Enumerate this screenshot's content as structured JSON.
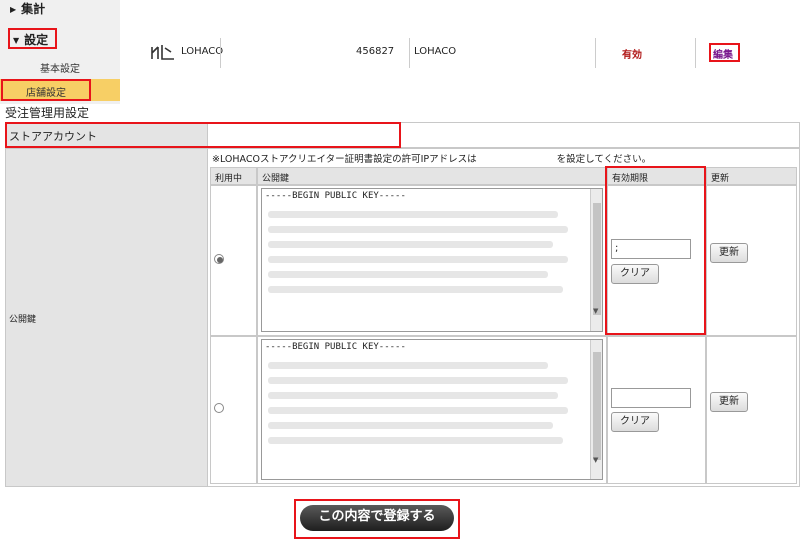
{
  "sidebar": {
    "aggregate_label": "集計",
    "settings_label": "設定",
    "basic_settings": "基本設定",
    "store_settings": "店舗設定"
  },
  "store_row": {
    "logo_text": "LOHACO",
    "store_id": "456827",
    "store_name": "LOHACO",
    "status": "有効",
    "edit_label": "編集"
  },
  "section_title": "受注管理用設定",
  "store_account": {
    "label": "ストアアカウント",
    "value": ""
  },
  "public_key": {
    "label": "公開鍵",
    "notice_prefix": "※LOHACOストアクリエイター証明書設定の許可IPアドレスは",
    "notice_suffix": "を設定してください。",
    "headers": {
      "in_use": "利用中",
      "key": "公開鍵",
      "expiry": "有効期限",
      "update": "更新"
    },
    "rows": [
      {
        "key_text": "-----BEGIN PUBLIC KEY-----",
        "selected": true,
        "expiry_value": ";",
        "clear_label": "クリア",
        "update_label": "更新"
      },
      {
        "key_text": "-----BEGIN PUBLIC KEY-----",
        "selected": false,
        "expiry_value": "",
        "clear_label": "クリア",
        "update_label": "更新"
      }
    ]
  },
  "submit_label": "この内容で登録する",
  "colors": {
    "highlight_red": "#e8141a",
    "active_menu": "#f7cf65",
    "status_red": "#b01818",
    "edit_purple": "#7a1a8f"
  }
}
